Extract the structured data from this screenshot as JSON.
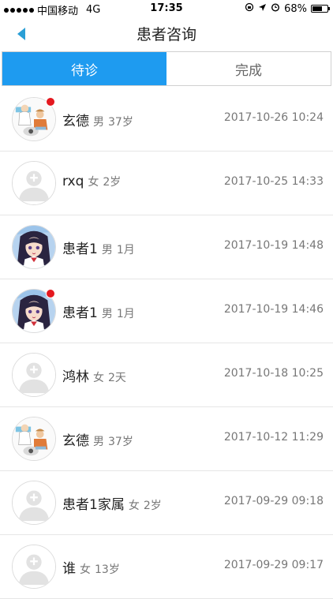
{
  "status_bar": {
    "carrier": "中国移动",
    "network": "4G",
    "time": "17:35",
    "battery": "68%",
    "battery_level": 0.68
  },
  "nav": {
    "title": "患者咨询",
    "accent_color": "#1e9bf0"
  },
  "tabs": [
    {
      "label": "待诊",
      "active": true
    },
    {
      "label": "完成",
      "active": false
    }
  ],
  "consultations": [
    {
      "name": "玄德",
      "gender": "男",
      "age": "37岁",
      "time": "2017-10-26 10:24",
      "unread": true,
      "avatar": "cartoon-avatar"
    },
    {
      "name": "rxq",
      "gender": "女",
      "age": "2岁",
      "time": "2017-10-25 14:33",
      "unread": false,
      "avatar": "default-avatar"
    },
    {
      "name": "患者1",
      "gender": "男",
      "age": "1月",
      "time": "2017-10-19 14:48",
      "unread": false,
      "avatar": "anime-avatar"
    },
    {
      "name": "患者1",
      "gender": "男",
      "age": "1月",
      "time": "2017-10-19 14:46",
      "unread": true,
      "avatar": "anime-avatar"
    },
    {
      "name": "鸿林",
      "gender": "女",
      "age": "2天",
      "time": "2017-10-18 10:25",
      "unread": false,
      "avatar": "default-avatar"
    },
    {
      "name": "玄德",
      "gender": "男",
      "age": "37岁",
      "time": "2017-10-12 11:29",
      "unread": false,
      "avatar": "cartoon-avatar"
    },
    {
      "name": "患者1家属",
      "gender": "女",
      "age": "2岁",
      "time": "2017-09-29 09:18",
      "unread": false,
      "avatar": "default-avatar"
    },
    {
      "name": "谁",
      "gender": "女",
      "age": "13岁",
      "time": "2017-09-29 09:17",
      "unread": false,
      "avatar": "default-avatar"
    }
  ]
}
